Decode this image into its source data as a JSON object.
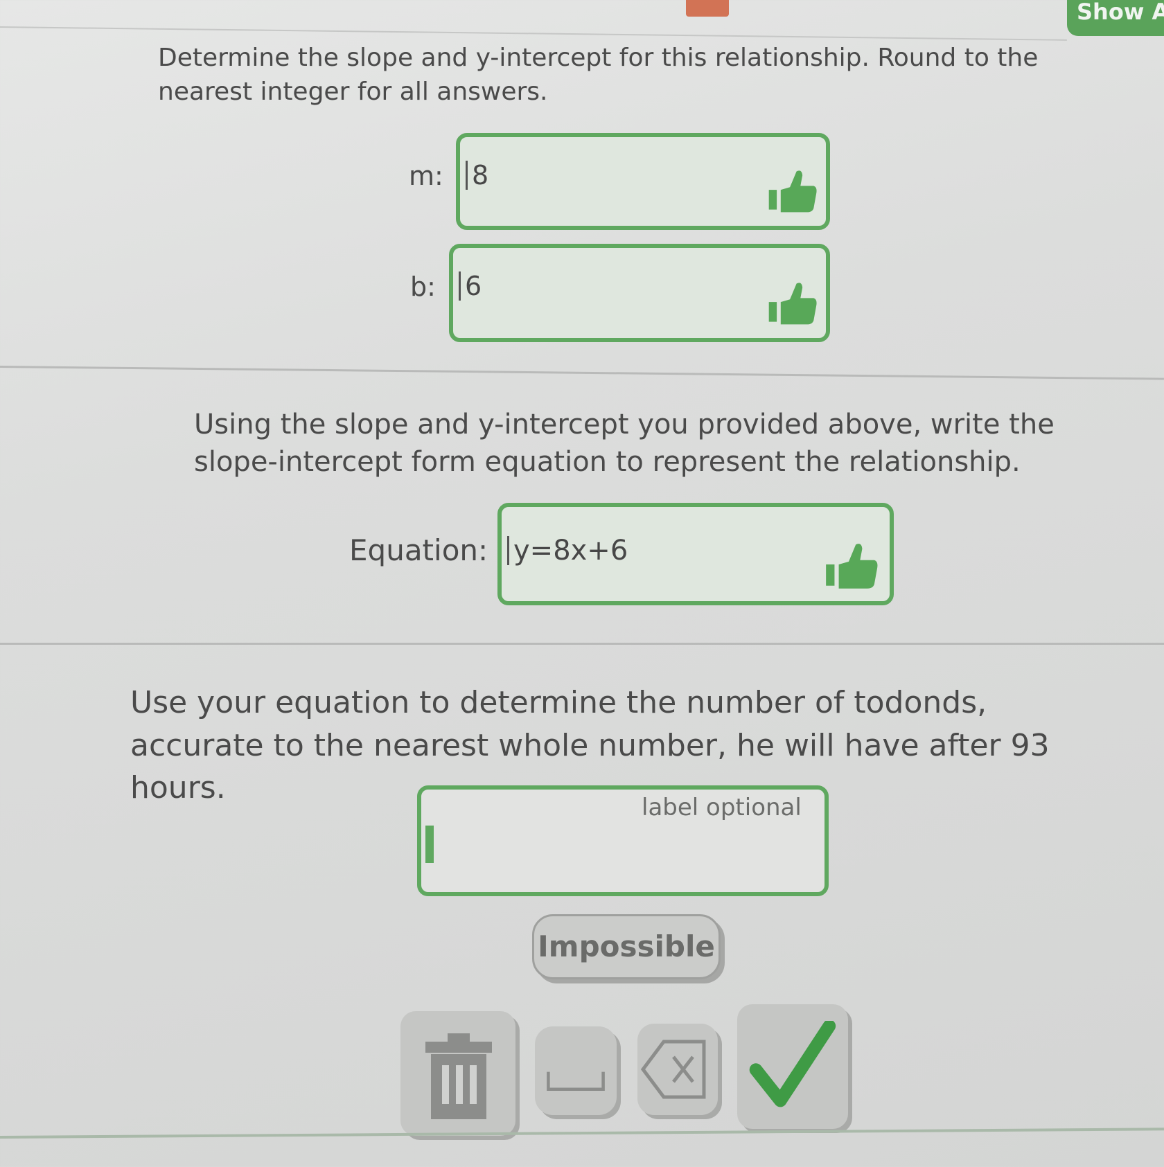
{
  "header": {
    "show_answer_label": "Show A"
  },
  "section1": {
    "prompt": "Determine the slope and y-intercept for this relationship. Round to the nearest integer for all answers.",
    "m_label": "m:",
    "m_value": "8",
    "b_label": "b:",
    "b_value": "6"
  },
  "section2": {
    "prompt": "Using the slope and y-intercept you provided above, write the slope-intercept form equation to represent the relationship.",
    "equation_label": "Equation:",
    "equation_value": "y=8x+6"
  },
  "section3": {
    "prompt": "Use your equation to determine the number of todonds, accurate to the nearest whole number, he will have after 93 hours.",
    "answer_value": "",
    "label_placeholder": "label optional",
    "impossible_label": "Impossible"
  },
  "keypad": {
    "delete_all_icon": "trash-icon",
    "space_icon": "space-icon",
    "backspace_icon": "backspace-icon",
    "submit_icon": "checkmark-icon"
  },
  "colors": {
    "accent_green": "#5fa85f",
    "thumb_green": "#58a858",
    "check_green": "#3f9b45"
  }
}
